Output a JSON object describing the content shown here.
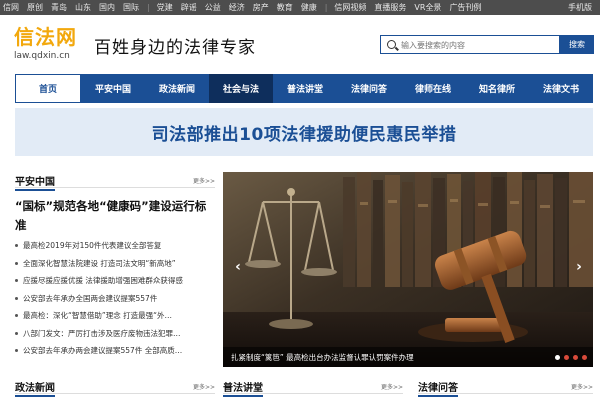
{
  "topbar": {
    "links": [
      "信网",
      "原创",
      "青岛",
      "山东",
      "国内",
      "国际",
      "|",
      "党建",
      "辟谣",
      "公益",
      "经济",
      "房产",
      "教育",
      "健康",
      "|",
      "信网视频",
      "直播服务",
      "VR全景",
      "广告刊例"
    ],
    "mobile": "手机版"
  },
  "logo": {
    "name": "信法网",
    "url": "law.qdxin.cn"
  },
  "slogan": "百姓身边的法律专家",
  "search": {
    "placeholder": "输入要搜索的内容",
    "button": "搜索"
  },
  "nav": {
    "items": [
      {
        "label": "首页",
        "state": "home"
      },
      {
        "label": "平安中国",
        "state": ""
      },
      {
        "label": "政法新闻",
        "state": ""
      },
      {
        "label": "社会与法",
        "state": "active"
      },
      {
        "label": "普法讲堂",
        "state": ""
      },
      {
        "label": "法律问答",
        "state": ""
      },
      {
        "label": "律师在线",
        "state": ""
      },
      {
        "label": "知名律所",
        "state": ""
      },
      {
        "label": "法律文书",
        "state": ""
      }
    ]
  },
  "banner": {
    "text": "司法部推出10项法律援助便民惠民举措"
  },
  "pingan": {
    "title": "平安中国",
    "more": "更多>>",
    "headline": "“国标”规范各地“健康码”建设运行标准",
    "items": [
      "最高检2019年对150件代表建议全部答复",
      "全面深化智慧法院建设 打造司法文明“新高地”",
      "应援尽援应援优援 法律援助增强困难群众获得感",
      "公安部去年承办全国两会建议提案557件",
      "最高检：深化“智慧借助”理念 打造最强“外…",
      "八部门发文：严厉打击涉及医疗废物违法犯罪…",
      "公安部去年承办两会建议提案557件 全部高质…"
    ]
  },
  "slider": {
    "caption": "扎紧制度“篱笆” 最高检出台办法监督认罪认罚案件办理",
    "prev": "‹",
    "next": "›"
  },
  "sections": {
    "zhengfa": {
      "title": "政法新闻",
      "more": "更多>>"
    },
    "pufa": {
      "title": "普法讲堂",
      "more": "更多>>"
    },
    "falv": {
      "title": "法律问答",
      "more": "更多>>"
    }
  },
  "colors": {
    "brand_blue": "#1b4f95",
    "logo_orange": "#f2a80d",
    "topbar": "#4d4d4d",
    "banner_bg": "#e2ebf6"
  }
}
